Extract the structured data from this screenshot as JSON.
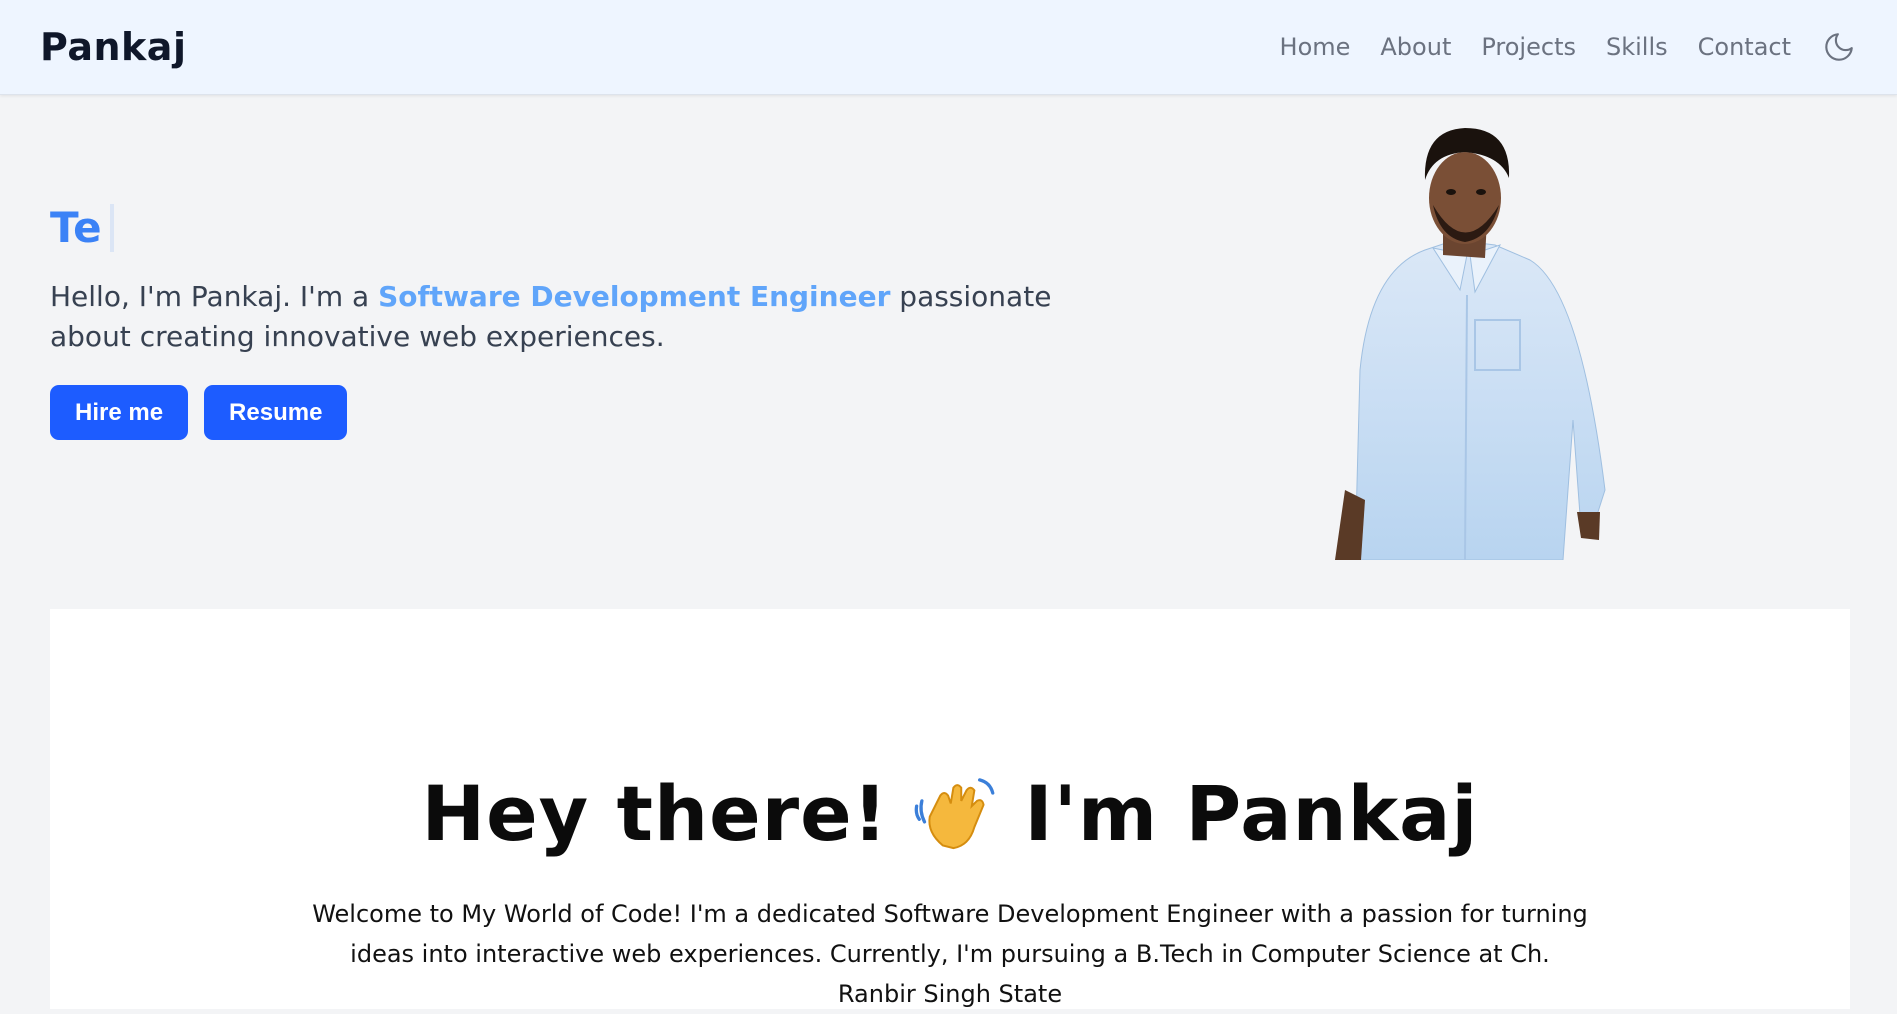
{
  "navbar": {
    "brand": "Pankaj",
    "links": [
      "Home",
      "About",
      "Projects",
      "Skills",
      "Contact"
    ],
    "theme_icon": "moon-icon"
  },
  "hero": {
    "typed_text": "Te",
    "intro_prefix": "Hello, I'm Pankaj. I'm a ",
    "intro_highlight": "Software Development Engineer",
    "intro_suffix": " passionate about creating innovative web experiences.",
    "buttons": {
      "hire": "Hire me",
      "resume": "Resume"
    }
  },
  "about": {
    "title_left": "Hey there!",
    "title_emoji": "waving-hand-icon",
    "title_right": "I'm Pankaj",
    "body": "Welcome to My World of Code! I'm a dedicated Software Development Engineer with a passion for turning ideas into interactive web experiences. Currently, I'm pursuing a B.Tech in Computer Science at Ch. Ranbir Singh State"
  },
  "colors": {
    "accent": "#1d5cff",
    "typed": "#3b82f6",
    "highlight": "#60a5fa",
    "nav_bg": "#eef5ff",
    "page_bg": "#f3f4f6"
  }
}
